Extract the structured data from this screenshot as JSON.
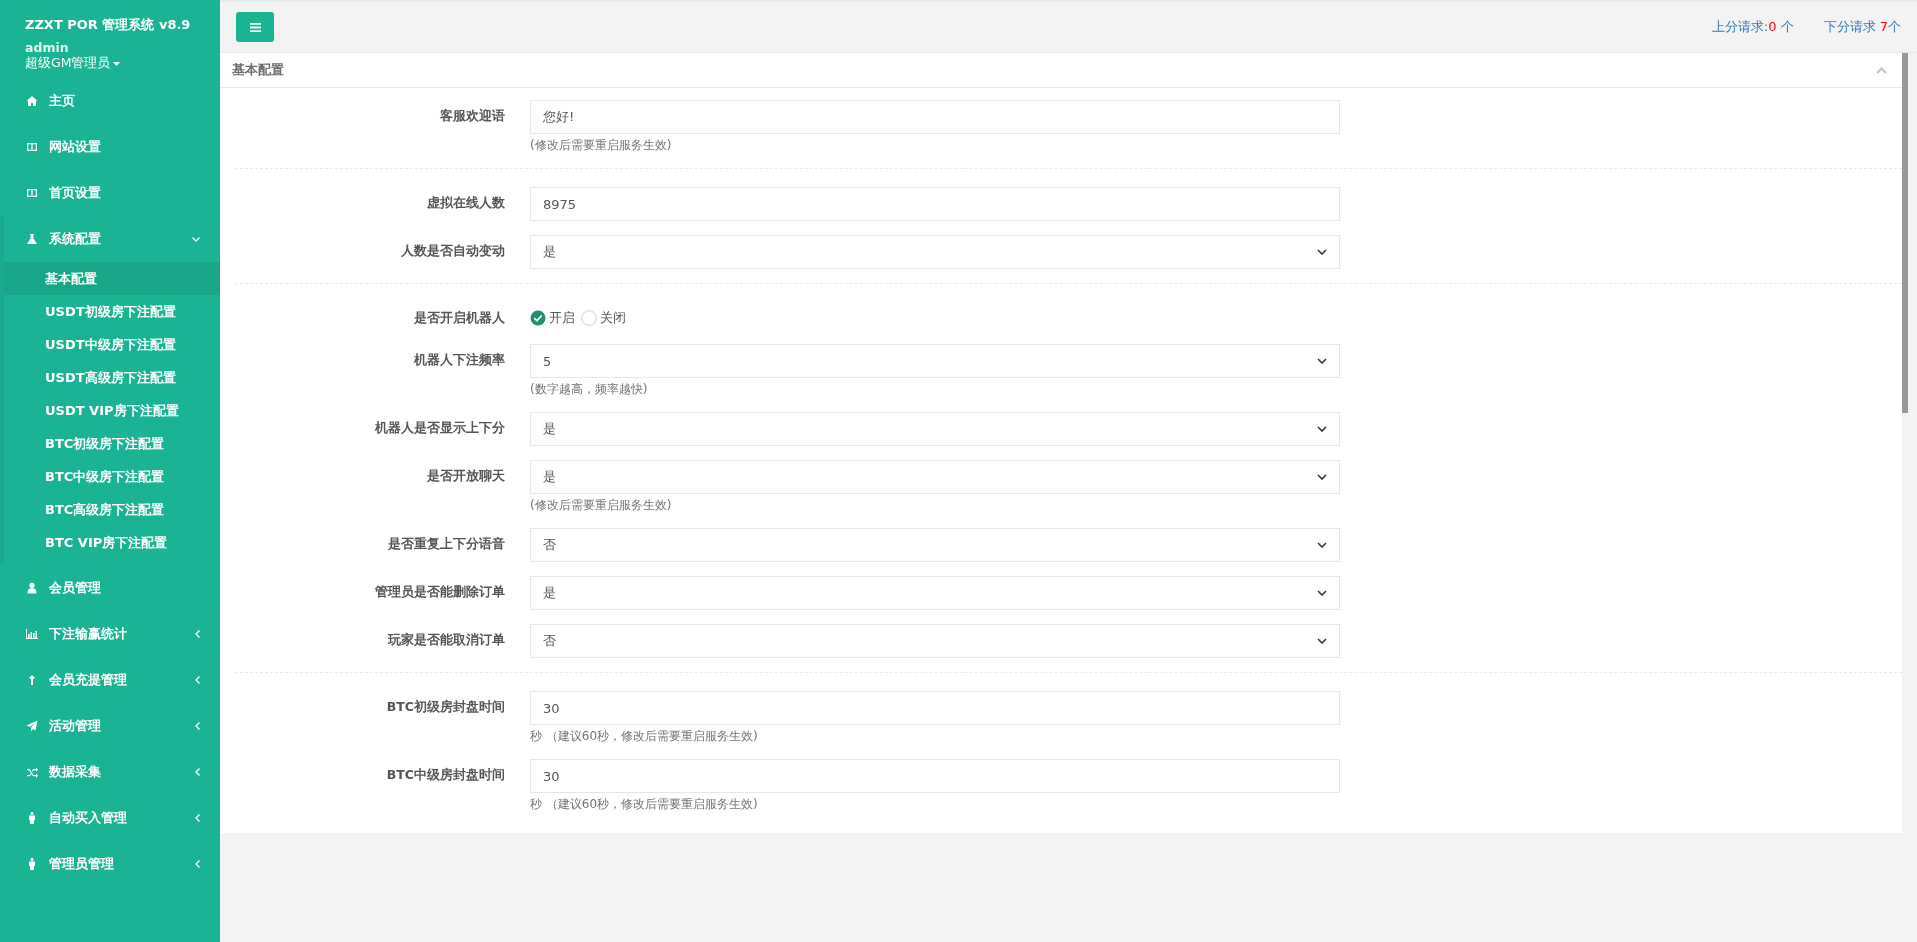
{
  "sidebar": {
    "brand": "ZZXT POR 管理系统 v8.9",
    "user": "admin",
    "role": "超级GM管理员",
    "items": [
      {
        "label": "主页"
      },
      {
        "label": "网站设置"
      },
      {
        "label": "首页设置"
      },
      {
        "label": "系统配置",
        "expanded": true,
        "children": [
          {
            "label": "基本配置",
            "selected": true
          },
          {
            "label": "USDT初级房下注配置",
            "selected": false
          },
          {
            "label": "USDT中级房下注配置",
            "selected": false
          },
          {
            "label": "USDT高级房下注配置",
            "selected": false
          },
          {
            "label": "USDT VIP房下注配置",
            "selected": false
          },
          {
            "label": "BTC初级房下注配置",
            "selected": false
          },
          {
            "label": "BTC中级房下注配置",
            "selected": false
          },
          {
            "label": "BTC高级房下注配置",
            "selected": false
          },
          {
            "label": "BTC VIP房下注配置",
            "selected": false
          }
        ]
      },
      {
        "label": "会员管理"
      },
      {
        "label": "下注输赢统计",
        "expanded": false
      },
      {
        "label": "会员充提管理",
        "expanded": false
      },
      {
        "label": "活动管理",
        "expanded": false
      },
      {
        "label": "数据采集",
        "expanded": false
      },
      {
        "label": "自动买入管理",
        "expanded": false
      },
      {
        "label": "管理员管理",
        "expanded": false
      }
    ]
  },
  "topbar": {
    "requests": [
      {
        "label": "上分请求:",
        "count": "0",
        "unit": " 个"
      },
      {
        "label": "下分请求 ",
        "count": "7",
        "unit": "个"
      }
    ]
  },
  "panel": {
    "title": "基本配置",
    "groups": [
      [
        {
          "kind": "text",
          "label": "客服欢迎语",
          "value": "您好!",
          "help": "(修改后需要重启服务生效)"
        }
      ],
      [
        {
          "kind": "text",
          "label": "虚拟在线人数",
          "value": "8975"
        },
        {
          "kind": "select",
          "label": "人数是否自动变动",
          "value": "是"
        }
      ],
      [
        {
          "kind": "radio",
          "label": "是否开启机器人",
          "options": [
            {
              "label": "开启",
              "selected": true
            },
            {
              "label": "关闭",
              "selected": false
            }
          ]
        },
        {
          "kind": "select",
          "label": "机器人下注频率",
          "value": "5",
          "help": "(数字越高，频率越快)"
        },
        {
          "kind": "select",
          "label": "机器人是否显示上下分",
          "value": "是"
        },
        {
          "kind": "select",
          "label": "是否开放聊天",
          "value": "是",
          "help": "(修改后需要重启服务生效)"
        },
        {
          "kind": "select",
          "label": "是否重复上下分语音",
          "value": "否"
        },
        {
          "kind": "select",
          "label": "管理员是否能删除订单",
          "value": "是"
        },
        {
          "kind": "select",
          "label": "玩家是否能取消订单",
          "value": "否"
        }
      ],
      [
        {
          "kind": "text",
          "label": "BTC初级房封盘时间",
          "value": "30",
          "help": "秒 （建议60秒，修改后需要重启服务生效)"
        },
        {
          "kind": "text",
          "label": "BTC中级房封盘时间",
          "value": "30",
          "help": "秒 （建议60秒，修改后需要重启服务生效)"
        }
      ]
    ]
  }
}
